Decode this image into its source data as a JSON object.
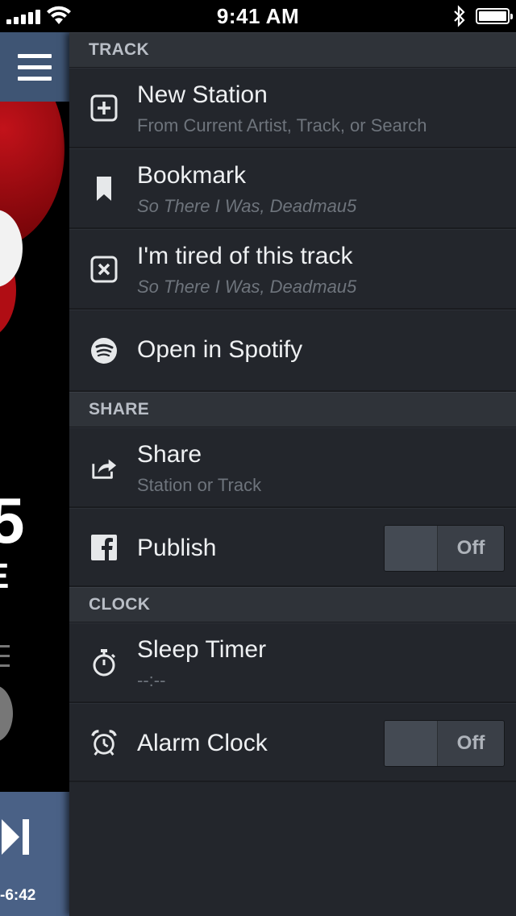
{
  "status_bar": {
    "time": "9:41 AM"
  },
  "player": {
    "time_remaining": "-6:42"
  },
  "sections": {
    "track": {
      "header": "TRACK",
      "new_station": {
        "title": "New Station",
        "subtitle": "From Current Artist, Track, or Search",
        "icon": "plus-square-icon"
      },
      "bookmark": {
        "title": "Bookmark",
        "subtitle": "So There I Was, Deadmau5",
        "icon": "bookmark-icon"
      },
      "tired": {
        "title": "I'm tired of this track",
        "subtitle": "So There I Was, Deadmau5",
        "icon": "x-square-icon"
      },
      "spotify": {
        "title": "Open in Spotify",
        "icon": "spotify-icon"
      }
    },
    "share": {
      "header": "SHARE",
      "share": {
        "title": "Share",
        "subtitle": "Station or Track",
        "icon": "share-icon"
      },
      "publish": {
        "title": "Publish",
        "toggle": "Off",
        "icon": "facebook-icon"
      }
    },
    "clock": {
      "header": "CLOCK",
      "sleep_timer": {
        "title": "Sleep Timer",
        "subtitle": "--:--",
        "icon": "stopwatch-icon"
      },
      "alarm": {
        "title": "Alarm Clock",
        "toggle": "Off",
        "icon": "alarm-clock-icon"
      }
    }
  },
  "colors": {
    "drawer_bg": "#23262c",
    "section_header_bg": "#2f3339",
    "menu_button_bg": "#3f5574",
    "player_bottom_bg": "#4a6186"
  }
}
